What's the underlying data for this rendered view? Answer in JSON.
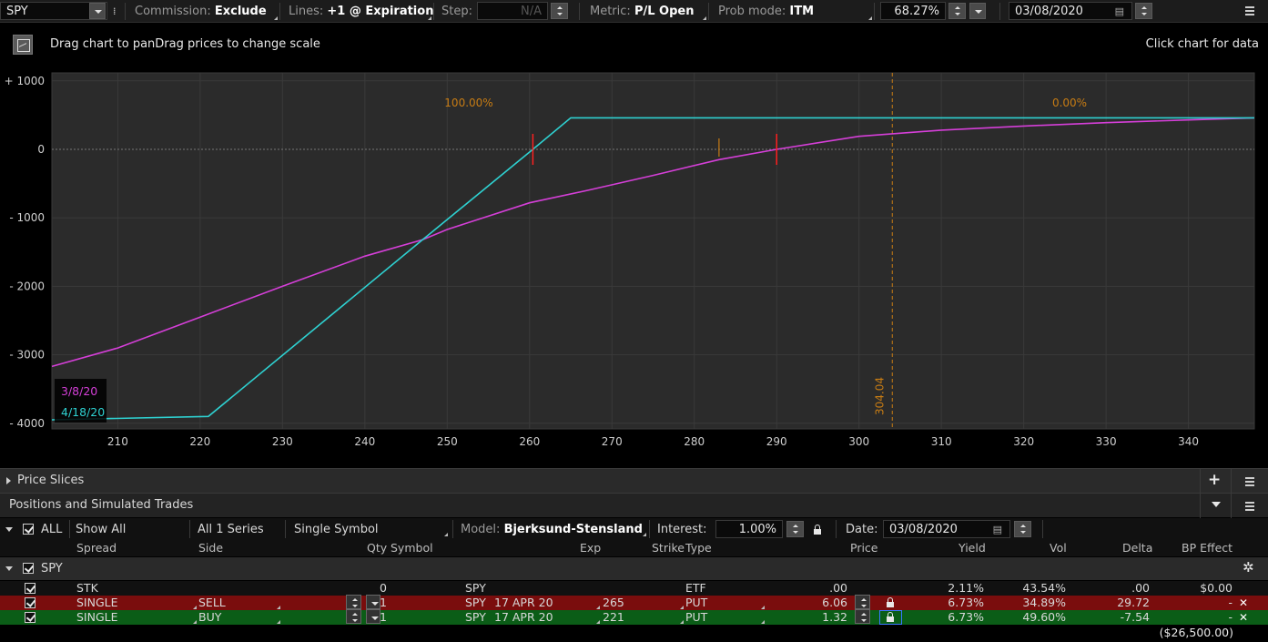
{
  "toolbar": {
    "symbol": "SPY",
    "commission_label": "Commission:",
    "commission_value": "Exclude",
    "lines_label": "Lines:",
    "lines_value": "+1 @ Expiration",
    "step_label": "Step:",
    "step_value": "N/A",
    "metric_label": "Metric:",
    "metric_value": "P/L Open",
    "prob_label": "Prob mode:",
    "prob_value": "ITM",
    "prob_percent": "68.27%",
    "date": "03/08/2020"
  },
  "chart_header": {
    "hint_left": "Drag chart to panDrag prices to change scale",
    "hint_right": "Click chart for data"
  },
  "chart_data": {
    "type": "line",
    "xlim": [
      202,
      348
    ],
    "ylim": [
      -4000,
      1100
    ],
    "x_ticks": [
      "210",
      "220",
      "230",
      "240",
      "250",
      "260",
      "270",
      "280",
      "290",
      "300",
      "310",
      "320",
      "330",
      "340"
    ],
    "x_tick_values": [
      210,
      220,
      230,
      240,
      250,
      260,
      270,
      280,
      290,
      300,
      310,
      320,
      330,
      340
    ],
    "y_ticks": [
      "+ 1000",
      "0",
      "- 1000",
      "- 2000",
      "- 3000",
      "- 4000"
    ],
    "y_tick_values": [
      1000,
      0,
      -1000,
      -2000,
      -3000,
      -4000
    ],
    "series": [
      {
        "name": "3/8/20",
        "color": "#d53fd8",
        "x": [
          202,
          210,
          220,
          230,
          240,
          247,
          250,
          260,
          267,
          275,
          283,
          290,
          300,
          310,
          320,
          330,
          340,
          348
        ],
        "y": [
          -3170,
          -2900,
          -2450,
          -2000,
          -1560,
          -1320,
          -1170,
          -780,
          -600,
          -380,
          -150,
          0,
          190,
          280,
          340,
          390,
          430,
          460
        ]
      },
      {
        "name": "4/18/20",
        "color": "#2ed1d1",
        "x": [
          202,
          221,
          247,
          260.4,
          265,
          348
        ],
        "y": [
          -3950,
          -3900,
          -1320,
          0,
          460,
          460
        ]
      }
    ],
    "annotations": {
      "prob_left": "100.00%",
      "prob_right": "0.00%",
      "current_price": "304.04",
      "current_price_value": 304.04,
      "breakevens": [
        260.4,
        290
      ],
      "marker_small": 283
    }
  },
  "panels": {
    "price_slices": "Price Slices",
    "positions": "Positions and Simulated Trades"
  },
  "filters": {
    "all": "ALL",
    "show_all": "Show All",
    "series": "All 1 Series",
    "single_symbol": "Single Symbol",
    "model_label": "Model:",
    "model_value": "Bjerksund-Stensland",
    "interest_label": "Interest:",
    "interest_value": "1.00%",
    "date_label": "Date:",
    "date_value": "03/08/2020"
  },
  "columns": [
    "Spread",
    "Side",
    "Qty",
    "Symbol",
    "Exp",
    "Strike",
    "Type",
    "Price",
    "Yield",
    "Vol",
    "Delta",
    "BP Effect"
  ],
  "group": "SPY",
  "rows": [
    {
      "spread": "STK",
      "side": "",
      "qty": "0",
      "symbol": "SPY",
      "exp": "",
      "strike": "",
      "type": "ETF",
      "price": ".00",
      "yield": "2.11%",
      "vol": "43.54%",
      "delta": ".00",
      "bp": "$0.00",
      "style": "plain"
    },
    {
      "spread": "SINGLE",
      "side": "SELL",
      "qty": "-1",
      "symbol": "SPY",
      "exp": "17 APR 20",
      "strike": "265",
      "type": "PUT",
      "price": "6.06",
      "yield": "6.73%",
      "vol": "34.89%",
      "delta": "29.72",
      "bp": "-",
      "style": "sell"
    },
    {
      "spread": "SINGLE",
      "side": "BUY",
      "qty": "+1",
      "symbol": "SPY",
      "exp": "17 APR 20",
      "strike": "221",
      "type": "PUT",
      "price": "1.32",
      "yield": "6.73%",
      "vol": "49.60%",
      "delta": "-7.54",
      "bp": "-",
      "style": "buy"
    }
  ],
  "total_bp": "($26,500.00)"
}
